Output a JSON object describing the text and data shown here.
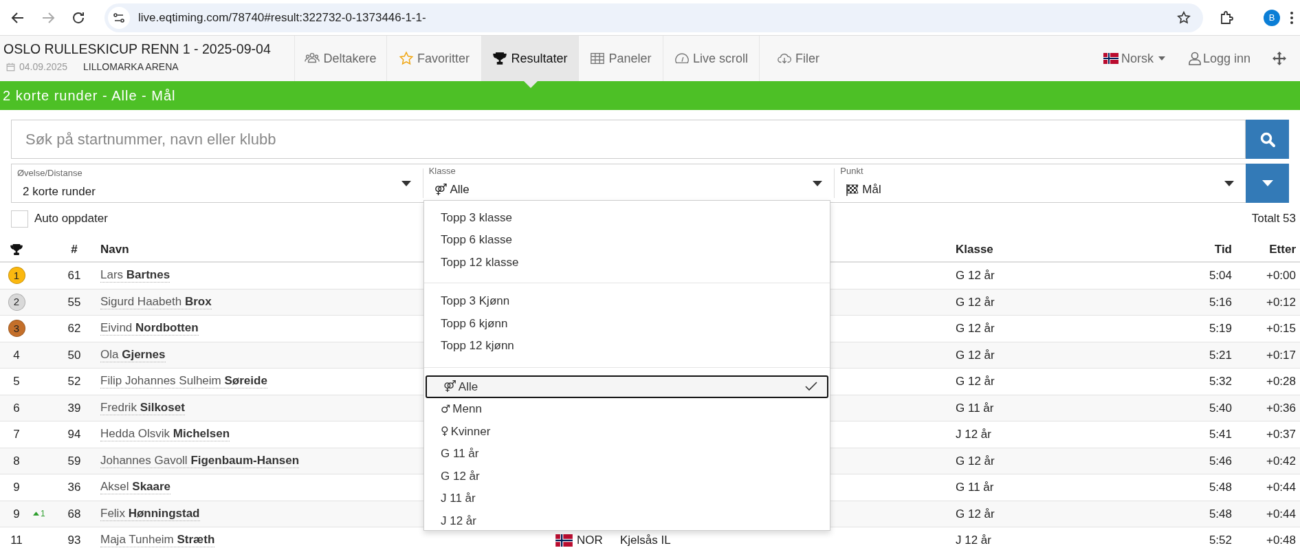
{
  "browser": {
    "url": "live.eqtiming.com/78740#result:322732-0-1373446-1-1-",
    "avatar": "B"
  },
  "header": {
    "title": "OSLO RULLESKICUP RENN 1 - 2025-09-04",
    "date": "04.09.2025",
    "venue": "LILLOMARKA ARENA",
    "tabs": [
      {
        "label": "Deltakere",
        "selected": false
      },
      {
        "label": "Favoritter",
        "selected": false
      },
      {
        "label": "Resultater",
        "selected": true
      },
      {
        "label": "Paneler",
        "selected": false
      },
      {
        "label": "Live scroll",
        "selected": false
      },
      {
        "label": "Filer",
        "selected": false
      }
    ],
    "language": "Norsk",
    "login": "Logg inn"
  },
  "banner": "2 korte runder - Alle - Mål",
  "search": {
    "placeholder": "Søk på startnummer, navn eller klubb"
  },
  "filters": [
    {
      "label": "Øvelse/Distanse",
      "value": "2 korte runder"
    },
    {
      "label": "Klasse",
      "symbol": "⚤",
      "value": "Alle"
    },
    {
      "label": "Punkt",
      "value": "Mål"
    }
  ],
  "auto_update": {
    "label": "Auto oppdater",
    "checked": false
  },
  "total": "Totalt 53",
  "table": {
    "columns": [
      {
        "kind": "icon"
      },
      {
        "kind": "text",
        "label": "#"
      },
      {
        "kind": "text",
        "label": "Navn"
      },
      {
        "kind": "text",
        "label": "Klasse"
      },
      {
        "kind": "text",
        "label": "Tid"
      },
      {
        "kind": "text",
        "label": "Etter"
      }
    ],
    "rows": [
      {
        "rank": "1",
        "color": "#fbb80f",
        "bib": "61",
        "name": "Lars **Bartnes**",
        "klasse": "G 12 år",
        "tid": "5:04",
        "etter": "+0:00"
      },
      {
        "rank": "2",
        "color": "#d9d9d9",
        "bib": "55",
        "name": "Sigurd Haabeth **Brox**",
        "klasse": "G 12 år",
        "tid": "5:16",
        "etter": "+0:12"
      },
      {
        "rank": "3",
        "color": "#c46f2a",
        "bib": "62",
        "name": "Eivind **Nordbotten**",
        "klasse": "G 12 år",
        "tid": "5:19",
        "etter": "+0:15"
      },
      {
        "rank": "4",
        "bib": "50",
        "name": "Ola **Gjernes**",
        "klasse": "G 12 år",
        "tid": "5:21",
        "etter": "+0:17"
      },
      {
        "rank": "5",
        "bib": "52",
        "name": "Filip Johannes Sulheim **Søreide**",
        "klasse": "G 12 år",
        "tid": "5:32",
        "etter": "+0:28"
      },
      {
        "rank": "6",
        "bib": "39",
        "name": "Fredrik **Silkoset**",
        "klasse": "G 11 år",
        "tid": "5:40",
        "etter": "+0:36"
      },
      {
        "rank": "7",
        "bib": "94",
        "name": "Hedda Olsvik **Michelsen**",
        "klasse": "J 12 år",
        "tid": "5:41",
        "etter": "+0:37"
      },
      {
        "rank": "8",
        "bib": "59",
        "name": "Johannes Gavoll **Figenbaum-Hansen**",
        "klasse": "G 12 år",
        "tid": "5:46",
        "etter": "+0:42"
      },
      {
        "rank": "9",
        "bib": "36",
        "name": "Aksel **Skaare**",
        "klasse": "G 11 år",
        "tid": "5:48",
        "etter": "+0:44"
      },
      {
        "rank": "9",
        "change": {
          "kind": "up",
          "value": "1"
        },
        "bib": "68",
        "name": "Felix **Hønningstad**",
        "klasse": "G 12 år",
        "tid": "5:48",
        "etter": "+0:44"
      },
      {
        "rank": "11",
        "bib": "93",
        "name": "Maja Tunheim **Stræth**",
        "nation": "NOR",
        "club": "Kjelsås IL",
        "klasse": "J 12 år",
        "tid": "5:52",
        "etter": "+0:48"
      }
    ]
  },
  "dropdown": {
    "groups": [
      [
        {
          "label": "Topp 3 klasse",
          "selected": false
        },
        {
          "label": "Topp 6 klasse",
          "selected": false
        },
        {
          "label": "Topp 12 klasse",
          "selected": false
        }
      ],
      [
        {
          "label": "Topp 3 Kjønn",
          "selected": false
        },
        {
          "label": "Topp 6 kjønn",
          "selected": false
        },
        {
          "label": "Topp 12 kjønn",
          "selected": false
        }
      ],
      [
        {
          "symbol": "⚤",
          "label": "Alle",
          "selected": true
        },
        {
          "symbol": "♂",
          "label": "Menn",
          "selected": false
        },
        {
          "symbol": "♀",
          "label": "Kvinner",
          "selected": false
        },
        {
          "label": "G 11 år",
          "selected": false
        },
        {
          "label": "G 12 år",
          "selected": false
        },
        {
          "label": "J 11 år",
          "selected": false
        },
        {
          "label": "J 12 år",
          "selected": false
        }
      ]
    ]
  }
}
